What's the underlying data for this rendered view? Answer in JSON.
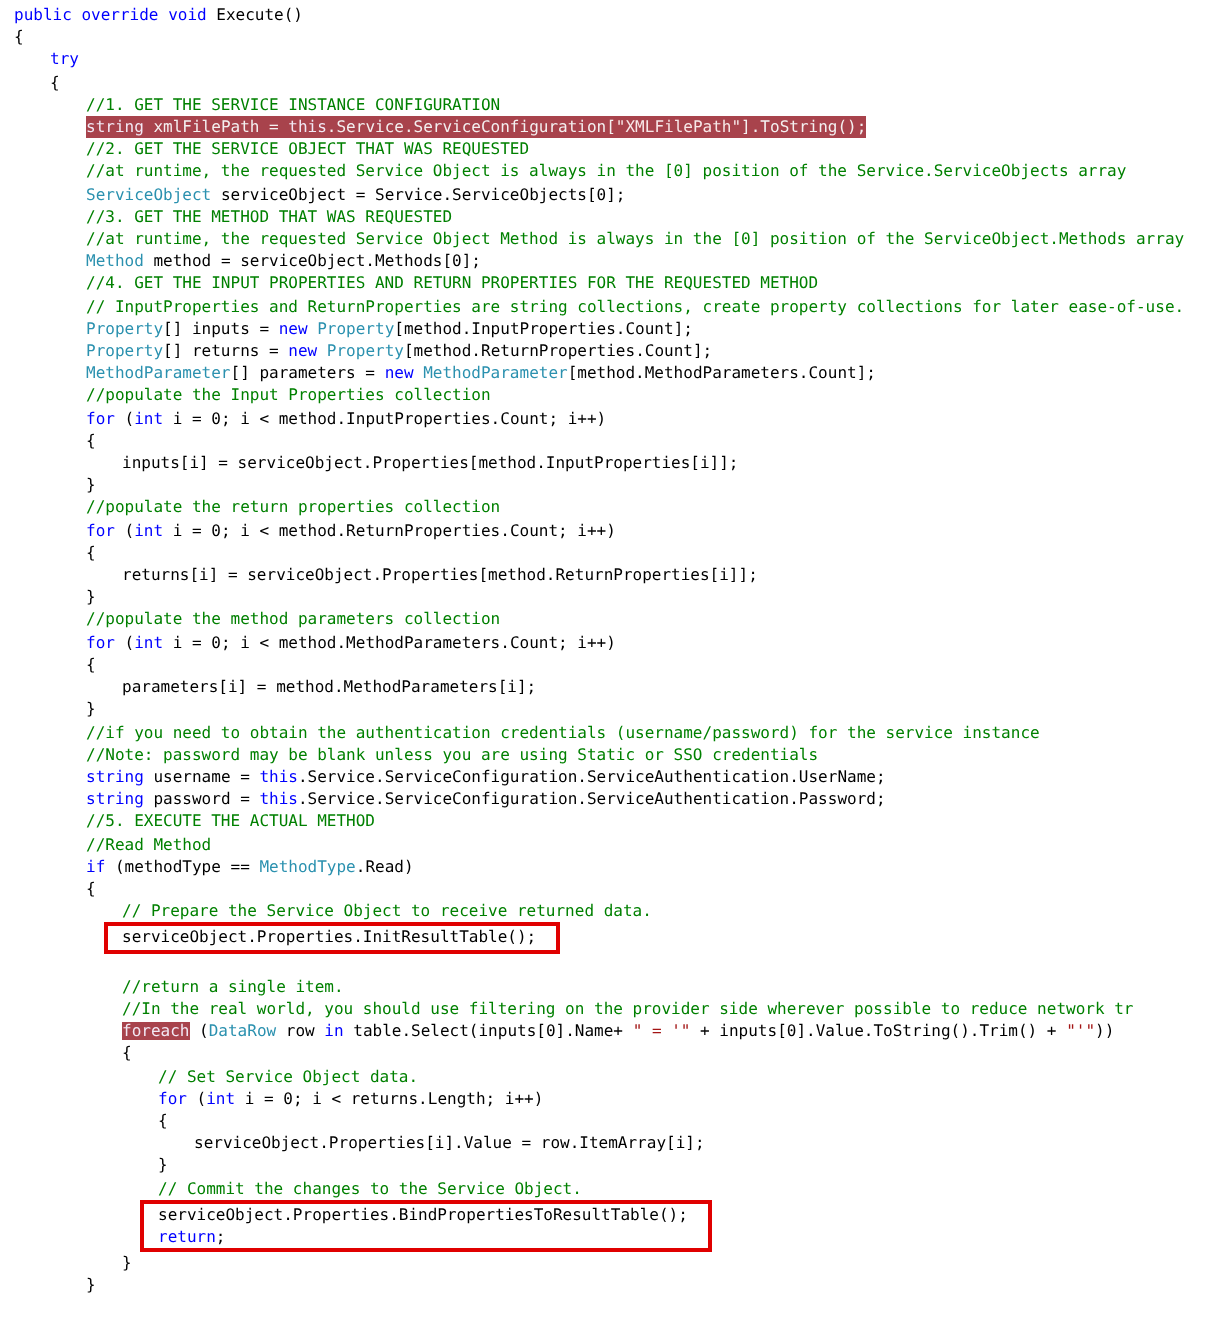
{
  "editor": {
    "lines": [
      {
        "kind": "code",
        "tokens": [
          {
            "text": "public override void",
            "kind": "keyword"
          },
          {
            "text": " Execute()",
            "kind": "plain"
          }
        ]
      },
      {
        "kind": "code",
        "tokens": [
          {
            "text": "{",
            "kind": "plain"
          }
        ],
        "children": [
          {
            "kind": "code",
            "tokens": [
              {
                "text": "try",
                "kind": "keyword"
              }
            ]
          },
          {
            "kind": "code",
            "tokens": [
              {
                "text": "{",
                "kind": "plain"
              }
            ],
            "children": [
              {
                "kind": "code",
                "tokens": [
                  {
                    "text": "//1. GET THE SERVICE INSTANCE CONFIGURATION",
                    "kind": "comment"
                  }
                ]
              },
              {
                "kind": "code",
                "highlighted": true,
                "tokens": [
                  {
                    "text": "string",
                    "kind": "keyword"
                  },
                  {
                    "text": " xmlFilePath = ",
                    "kind": "plain"
                  },
                  {
                    "text": "this",
                    "kind": "keyword"
                  },
                  {
                    "text": ".Service.ServiceConfiguration[",
                    "kind": "plain"
                  },
                  {
                    "text": "\"XMLFilePath\"",
                    "kind": "string"
                  },
                  {
                    "text": "].ToString();",
                    "kind": "plain"
                  }
                ]
              },
              {
                "kind": "code",
                "tokens": [
                  {
                    "text": "//2. GET THE SERVICE OBJECT THAT WAS REQUESTED",
                    "kind": "comment"
                  }
                ]
              },
              {
                "kind": "code",
                "tokens": [
                  {
                    "text": "//at runtime, the requested Service Object is always in the [0] position of the Service.ServiceObjects array",
                    "kind": "comment"
                  }
                ]
              },
              {
                "kind": "code",
                "tokens": [
                  {
                    "text": "ServiceObject",
                    "kind": "class"
                  },
                  {
                    "text": " serviceObject = Service.ServiceObjects[0];",
                    "kind": "plain"
                  }
                ]
              },
              {
                "kind": "code",
                "tokens": [
                  {
                    "text": "//3. GET THE METHOD THAT WAS REQUESTED",
                    "kind": "comment"
                  }
                ]
              },
              {
                "kind": "code",
                "tokens": [
                  {
                    "text": "//at runtime, the requested Service Object Method is always in the [0] position of the ServiceObject.Methods array",
                    "kind": "comment"
                  }
                ]
              },
              {
                "kind": "code",
                "tokens": [
                  {
                    "text": "Method",
                    "kind": "class"
                  },
                  {
                    "text": " method = serviceObject.Methods[0];",
                    "kind": "plain"
                  }
                ]
              },
              {
                "kind": "code",
                "tokens": [
                  {
                    "text": "//4. GET THE INPUT PROPERTIES AND RETURN PROPERTIES FOR THE REQUESTED METHOD",
                    "kind": "comment"
                  }
                ]
              },
              {
                "kind": "code",
                "tokens": [
                  {
                    "text": "// InputProperties and ReturnProperties are string collections, create property collections for later ease-of-use.",
                    "kind": "comment"
                  }
                ]
              },
              {
                "kind": "code",
                "tokens": [
                  {
                    "text": "Property",
                    "kind": "class"
                  },
                  {
                    "text": "[] inputs = ",
                    "kind": "plain"
                  },
                  {
                    "text": "new",
                    "kind": "keyword"
                  },
                  {
                    "text": " Property",
                    "kind": "class"
                  },
                  {
                    "text": "[method.InputProperties.Count];",
                    "kind": "plain"
                  }
                ]
              },
              {
                "kind": "code",
                "tokens": [
                  {
                    "text": "Property",
                    "kind": "class"
                  },
                  {
                    "text": "[] returns = ",
                    "kind": "plain"
                  },
                  {
                    "text": "new",
                    "kind": "keyword"
                  },
                  {
                    "text": " Property",
                    "kind": "class"
                  },
                  {
                    "text": "[method.ReturnProperties.Count];",
                    "kind": "plain"
                  }
                ]
              },
              {
                "kind": "code",
                "tokens": [
                  {
                    "text": "MethodParameter",
                    "kind": "class"
                  },
                  {
                    "text": "[] parameters = ",
                    "kind": "plain"
                  },
                  {
                    "text": "new",
                    "kind": "keyword"
                  },
                  {
                    "text": " MethodParameter",
                    "kind": "class"
                  },
                  {
                    "text": "[method.MethodParameters.Count];",
                    "kind": "plain"
                  }
                ]
              },
              {
                "kind": "code",
                "tokens": [
                  {
                    "text": "//populate the Input Properties collection",
                    "kind": "comment"
                  }
                ]
              },
              {
                "kind": "code",
                "tokens": [
                  {
                    "text": "for",
                    "kind": "keyword"
                  },
                  {
                    "text": " (",
                    "kind": "plain"
                  },
                  {
                    "text": "int",
                    "kind": "keyword"
                  },
                  {
                    "text": " i = 0; i < method.InputProperties.Count; i++)",
                    "kind": "plain"
                  }
                ]
              },
              {
                "kind": "code",
                "tokens": [
                  {
                    "text": "{",
                    "kind": "plain"
                  }
                ],
                "children": [
                  {
                    "kind": "code",
                    "tokens": [
                      {
                        "text": "inputs[i] = serviceObject.Properties[method.InputProperties[i]];",
                        "kind": "plain"
                      }
                    ]
                  }
                ]
              },
              {
                "kind": "code",
                "tokens": [
                  {
                    "text": "}",
                    "kind": "plain"
                  }
                ]
              },
              {
                "kind": "code",
                "tokens": [
                  {
                    "text": "//populate the return properties collection",
                    "kind": "comment"
                  }
                ]
              },
              {
                "kind": "code",
                "tokens": [
                  {
                    "text": "for",
                    "kind": "keyword"
                  },
                  {
                    "text": " (",
                    "kind": "plain"
                  },
                  {
                    "text": "int",
                    "kind": "keyword"
                  },
                  {
                    "text": " i = 0; i < method.ReturnProperties.Count; i++)",
                    "kind": "plain"
                  }
                ]
              },
              {
                "kind": "code",
                "tokens": [
                  {
                    "text": "{",
                    "kind": "plain"
                  }
                ],
                "children": [
                  {
                    "kind": "code",
                    "tokens": [
                      {
                        "text": "returns[i] = serviceObject.Properties[method.ReturnProperties[i]];",
                        "kind": "plain"
                      }
                    ]
                  }
                ]
              },
              {
                "kind": "code",
                "tokens": [
                  {
                    "text": "}",
                    "kind": "plain"
                  }
                ]
              },
              {
                "kind": "code",
                "tokens": [
                  {
                    "text": "//populate the method parameters collection",
                    "kind": "comment"
                  }
                ]
              },
              {
                "kind": "code",
                "tokens": [
                  {
                    "text": "for",
                    "kind": "keyword"
                  },
                  {
                    "text": " (",
                    "kind": "plain"
                  },
                  {
                    "text": "int",
                    "kind": "keyword"
                  },
                  {
                    "text": " i = 0; i < method.MethodParameters.Count; i++)",
                    "kind": "plain"
                  }
                ]
              },
              {
                "kind": "code",
                "tokens": [
                  {
                    "text": "{",
                    "kind": "plain"
                  }
                ],
                "children": [
                  {
                    "kind": "code",
                    "tokens": [
                      {
                        "text": "parameters[i] = method.MethodParameters[i];",
                        "kind": "plain"
                      }
                    ]
                  }
                ]
              },
              {
                "kind": "code",
                "tokens": [
                  {
                    "text": "}",
                    "kind": "plain"
                  }
                ]
              },
              {
                "kind": "code",
                "tokens": [
                  {
                    "text": "//if you need to obtain the authentication credentials (username/password) for the service instance",
                    "kind": "comment"
                  }
                ]
              },
              {
                "kind": "code",
                "tokens": [
                  {
                    "text": "//Note: password may be blank unless you are using Static or SSO credentials",
                    "kind": "comment"
                  }
                ]
              },
              {
                "kind": "code",
                "tokens": [
                  {
                    "text": "string",
                    "kind": "keyword"
                  },
                  {
                    "text": " username = ",
                    "kind": "plain"
                  },
                  {
                    "text": "this",
                    "kind": "keyword"
                  },
                  {
                    "text": ".Service.ServiceConfiguration.ServiceAuthentication.UserName;",
                    "kind": "plain"
                  }
                ]
              },
              {
                "kind": "code",
                "tokens": [
                  {
                    "text": "string",
                    "kind": "keyword"
                  },
                  {
                    "text": " password = ",
                    "kind": "plain"
                  },
                  {
                    "text": "this",
                    "kind": "keyword"
                  },
                  {
                    "text": ".Service.ServiceConfiguration.ServiceAuthentication.Password;",
                    "kind": "plain"
                  }
                ]
              },
              {
                "kind": "code",
                "tokens": [
                  {
                    "text": "//5. EXECUTE THE ACTUAL METHOD",
                    "kind": "comment"
                  }
                ]
              },
              {
                "kind": "code",
                "tokens": [
                  {
                    "text": "//Read Method",
                    "kind": "comment"
                  }
                ]
              },
              {
                "kind": "code",
                "tokens": [
                  {
                    "text": "if",
                    "kind": "keyword"
                  },
                  {
                    "text": " (methodType == ",
                    "kind": "plain"
                  },
                  {
                    "text": "MethodType",
                    "kind": "class"
                  },
                  {
                    "text": ".Read)",
                    "kind": "plain"
                  }
                ]
              },
              {
                "kind": "code",
                "tokens": [
                  {
                    "text": "{",
                    "kind": "plain"
                  }
                ],
                "children": [
                  {
                    "kind": "code",
                    "tokens": [
                      {
                        "text": "// Prepare the Service Object to receive returned data.",
                        "kind": "comment"
                      }
                    ]
                  },
                  {
                    "kind": "annotation_box",
                    "lines": [
                      {
                        "kind": "code",
                        "tokens": [
                          {
                            "text": "serviceObject.Properties.InitResultTable();",
                            "kind": "plain"
                          }
                        ]
                      }
                    ]
                  },
                  {
                    "kind": "blank"
                  },
                  {
                    "kind": "code",
                    "tokens": [
                      {
                        "text": "//return a single item.",
                        "kind": "comment"
                      }
                    ]
                  },
                  {
                    "kind": "code",
                    "tokens": [
                      {
                        "text": "//In the real world, you should use filtering on the provider side wherever possible to reduce network tr",
                        "kind": "comment"
                      }
                    ]
                  },
                  {
                    "kind": "code",
                    "tokens": [
                      {
                        "text": "foreach",
                        "kind": "keyword",
                        "highlighted": true
                      },
                      {
                        "text": " (",
                        "kind": "plain"
                      },
                      {
                        "text": "DataRow",
                        "kind": "class"
                      },
                      {
                        "text": " row ",
                        "kind": "plain"
                      },
                      {
                        "text": "in",
                        "kind": "keyword"
                      },
                      {
                        "text": " table.Select(inputs[0].Name+ ",
                        "kind": "plain"
                      },
                      {
                        "text": "\" = '\"",
                        "kind": "string"
                      },
                      {
                        "text": " + inputs[0].Value.ToString().Trim() + ",
                        "kind": "plain"
                      },
                      {
                        "text": "\"'\"",
                        "kind": "string"
                      },
                      {
                        "text": "))",
                        "kind": "plain"
                      }
                    ]
                  },
                  {
                    "kind": "code",
                    "tokens": [
                      {
                        "text": "{",
                        "kind": "plain"
                      }
                    ],
                    "children": [
                      {
                        "kind": "code",
                        "tokens": [
                          {
                            "text": "// Set Service Object data.",
                            "kind": "comment"
                          }
                        ]
                      },
                      {
                        "kind": "code",
                        "tokens": [
                          {
                            "text": "for",
                            "kind": "keyword"
                          },
                          {
                            "text": " (",
                            "kind": "plain"
                          },
                          {
                            "text": "int",
                            "kind": "keyword"
                          },
                          {
                            "text": " i = 0; i < returns.Length; i++)",
                            "kind": "plain"
                          }
                        ]
                      },
                      {
                        "kind": "code",
                        "tokens": [
                          {
                            "text": "{",
                            "kind": "plain"
                          }
                        ],
                        "children": [
                          {
                            "kind": "code",
                            "tokens": [
                              {
                                "text": "serviceObject.Properties[i].Value = row.ItemArray[i];",
                                "kind": "plain"
                              }
                            ]
                          }
                        ]
                      },
                      {
                        "kind": "code",
                        "tokens": [
                          {
                            "text": "}",
                            "kind": "plain"
                          }
                        ]
                      },
                      {
                        "kind": "code",
                        "tokens": [
                          {
                            "text": "// Commit the changes to the Service Object.",
                            "kind": "comment"
                          }
                        ]
                      },
                      {
                        "kind": "annotation_box",
                        "lines": [
                          {
                            "kind": "code",
                            "tokens": [
                              {
                                "text": "serviceObject.Properties.BindPropertiesToResultTable();",
                                "kind": "plain"
                              }
                            ]
                          },
                          {
                            "kind": "code",
                            "tokens": [
                              {
                                "text": "return",
                                "kind": "keyword"
                              },
                              {
                                "text": ";",
                                "kind": "plain"
                              }
                            ]
                          }
                        ]
                      }
                    ]
                  },
                  {
                    "kind": "code",
                    "tokens": [
                      {
                        "text": "}",
                        "kind": "plain"
                      }
                    ]
                  }
                ]
              },
              {
                "kind": "code",
                "tokens": [
                  {
                    "text": "}",
                    "kind": "plain"
                  }
                ]
              }
            ]
          }
        ]
      }
    ]
  }
}
